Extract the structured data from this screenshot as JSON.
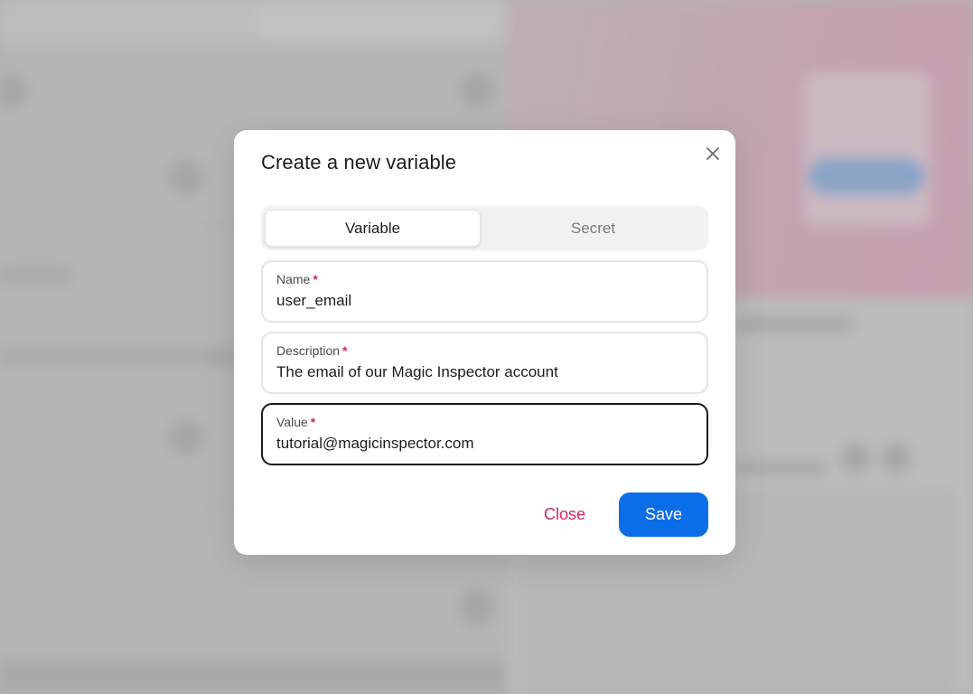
{
  "modal": {
    "title": "Create a new variable",
    "close_icon": "close-icon",
    "tabs": [
      {
        "label": "Variable",
        "active": true
      },
      {
        "label": "Secret",
        "active": false
      }
    ],
    "fields": {
      "name": {
        "label": "Name",
        "required_mark": "*",
        "value": "user_email"
      },
      "description": {
        "label": "Description",
        "required_mark": "*",
        "value": "The email of our Magic Inspector account"
      },
      "value": {
        "label": "Value",
        "required_mark": "*",
        "value": "tutorial@magicinspector.com",
        "focused": true
      }
    },
    "actions": {
      "close_label": "Close",
      "save_label": "Save"
    }
  },
  "colors": {
    "accent_blue": "#0b6ee8",
    "required_red": "#d6245f",
    "overlay_gray": "#b3b3b3"
  }
}
